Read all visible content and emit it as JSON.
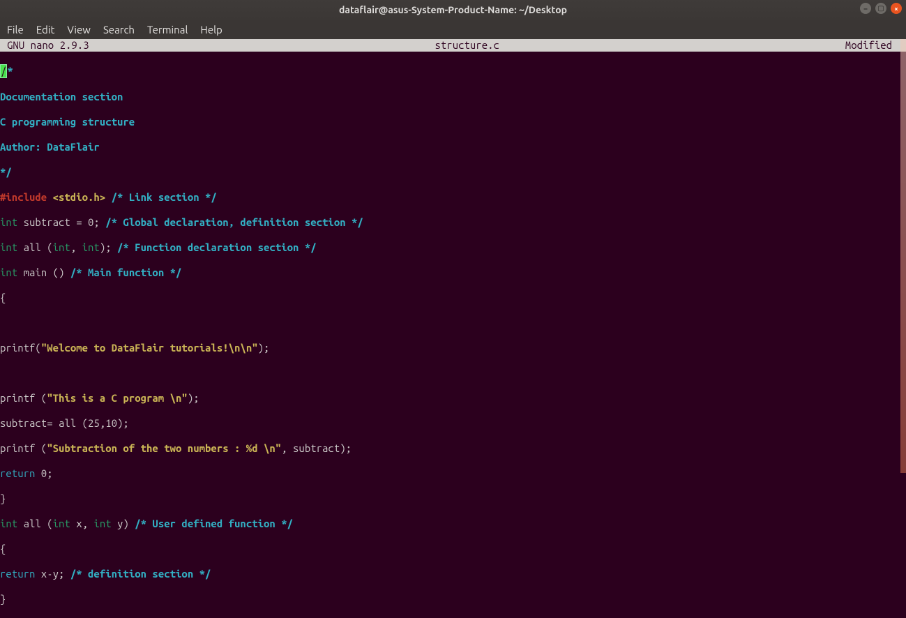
{
  "title": "dataflair@asus-System-Product-Name: ~/Desktop",
  "menu": [
    "File",
    "Edit",
    "View",
    "Search",
    "Terminal",
    "Help"
  ],
  "status": {
    "left": "  GNU nano 2.9.3",
    "center": "structure.c",
    "right": "Modified"
  },
  "code": {
    "l1a": "/",
    "l1b": "*",
    "l2": "Documentation section",
    "l3": "C programming structure",
    "l4": "Author: DataFlair",
    "l5": "*/",
    "l6a": "#include ",
    "l6b": "<stdio.h>",
    "l6c": " /* Link section */",
    "l7a": "int",
    "l7b": " subtract = 0; ",
    "l7c": "/* Global declaration, definition section */",
    "l8a": "int",
    "l8b": " all (",
    "l8c": "int",
    "l8d": ", ",
    "l8e": "int",
    "l8f": "); ",
    "l8g": "/* Function declaration section */",
    "l9a": "int",
    "l9b": " main () ",
    "l9c": "/* Main function */",
    "l10": "{",
    "l12a": "printf(",
    "l12b": "\"Welcome to DataFlair tutorials!\\n\\n\"",
    "l12c": ");",
    "l14a": "printf (",
    "l14b": "\"This is a C program \\n\"",
    "l14c": ");",
    "l15": "subtract= all (25,10);",
    "l16a": "printf (",
    "l16b": "\"Subtraction of the two numbers : %d \\n\"",
    "l16c": ", subtract);",
    "l17a": "return",
    "l17b": " 0;",
    "l18": "}",
    "l19a": "int",
    "l19b": " all (",
    "l19c": "int",
    "l19d": " x, ",
    "l19e": "int",
    "l19f": " y) ",
    "l19g": "/* User defined function */",
    "l20": "{",
    "l21a": "return",
    "l21b": " x-y; ",
    "l21c": "/* definition section */",
    "l22": "}"
  }
}
